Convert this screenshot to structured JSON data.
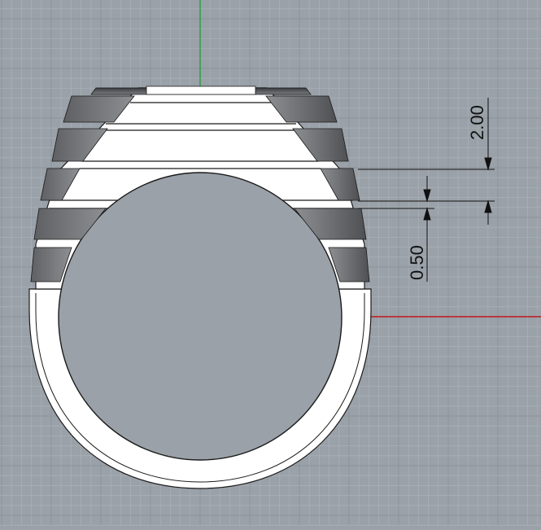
{
  "viewport": {
    "background": "#9aa1a8",
    "grid_minor_color": "#a9afb5",
    "grid_major_color": "#8c939a",
    "x_axis_color": "#c0181c",
    "y_axis_color": "#2ea043"
  },
  "dimensions": {
    "top_value": "2.00",
    "bottom_value": "0.50"
  }
}
